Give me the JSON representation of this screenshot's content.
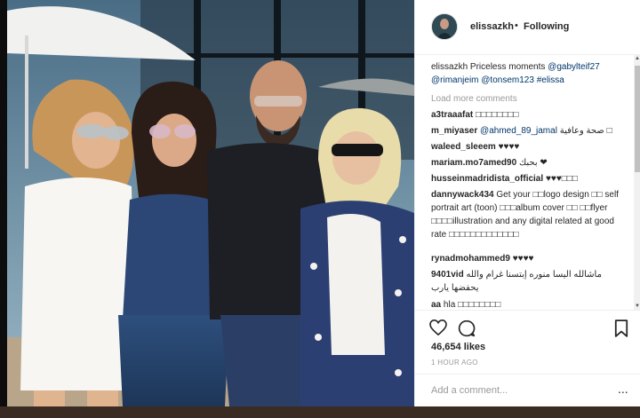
{
  "header": {
    "username": "elissazkh",
    "separator": "•",
    "follow_label": "Following",
    "avatar_icon": "profile-avatar"
  },
  "caption": {
    "user": "elissazkh",
    "text": "Priceless moments",
    "mentions": [
      "@gabylteif27",
      "@rimanjeim",
      "@tonsem123",
      "#elissa"
    ]
  },
  "load_more_label": "Load more comments",
  "comments": [
    {
      "user": "a3traaafat",
      "text": "□□□□□□□□"
    },
    {
      "user": "m_miyaser",
      "text": "صحة وعافية",
      "mention": "@ahmed_89_jamal",
      "tail": "□"
    },
    {
      "user": "waleed_sleeem",
      "text": "♥♥♥♥"
    },
    {
      "user": "mariam.mo7amed90",
      "text": "بحبك ❤"
    },
    {
      "user": "husseinmadridista_official",
      "text": "♥♥♥□□□"
    },
    {
      "user": "dannywack434",
      "text": "Get your □□logo design □□ self portrait art (toon) □□□album cover □□ □□flyer □□□□illustration and any digital related at good rate □□□□□□□□□□□□□"
    },
    {
      "user": "rynadmohammed9",
      "text": "♥♥♥♥"
    },
    {
      "user": "9401vid",
      "text": "ماشالله اليسا منوره إبتسنا غرام والله يحفضها يارب"
    },
    {
      "user": "aa",
      "text": "hla □□□□□□□□"
    }
  ],
  "actions": {
    "like_icon": "heart-icon",
    "comment_icon": "comment-icon",
    "save_icon": "bookmark-icon",
    "likes": "46,654 likes",
    "time": "1 HOUR AGO"
  },
  "add_comment": {
    "placeholder": "Add a comment...",
    "more_label": "..."
  },
  "colors": {
    "text": "#262626",
    "link": "#003569",
    "muted": "#999999",
    "border": "#efefef"
  }
}
